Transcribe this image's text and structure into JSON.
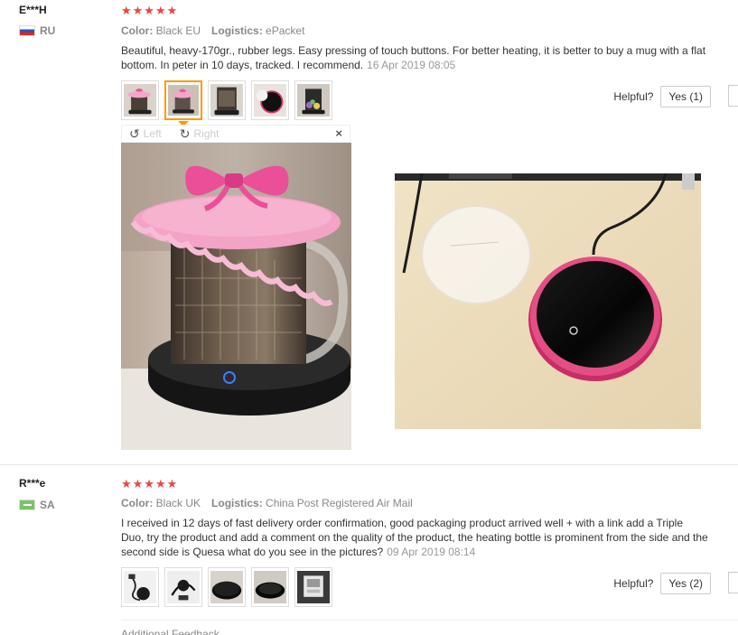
{
  "reviews": [
    {
      "user": "E***H",
      "country": "RU",
      "stars": "★★★★★",
      "color_label": "Color:",
      "color_value": "Black EU",
      "logistics_label": "Logistics:",
      "logistics_value": "ePacket",
      "text": "Beautiful, heavy-170gr., rubber legs. Easy pressing of touch buttons. For better heating, it is better to buy a mug with a flat bottom. In peter in 10 days, tracked. I recommend.",
      "date": "16 Apr 2019 08:05",
      "helpful_label": "Helpful?",
      "yes_label": "Yes (1)",
      "thumb_icons": [
        "mug-pink-lid-photo",
        "mug-pink-lid-photo",
        "mug-dark-photo",
        "warmer-photo",
        "mug-flowers-photo"
      ]
    },
    {
      "user": "R***e",
      "country": "SA",
      "stars": "★★★★★",
      "color_label": "Color:",
      "color_value": "Black UK",
      "logistics_label": "Logistics:",
      "logistics_value": "China Post Registered Air Mail",
      "text": "I received in 12 days of fast delivery order confirmation, good packaging product arrived well + with a link add a Triple Duo, try the product and add a comment on the quality of the product, the heating bottle is prominent from the side and the second side is Quesa what do you see in the pictures?",
      "date": "09 Apr 2019 08:14",
      "helpful_label": "Helpful?",
      "yes_label": "Yes (2)",
      "thumb_icons": [
        "cable-photo",
        "warmer-cable-photo",
        "warmer-black-photo",
        "warmer-top-photo",
        "box-photo"
      ]
    }
  ],
  "viewer": {
    "left_label": "Left",
    "right_label": "Right",
    "close_glyph": "×"
  },
  "additional_feedback": "Additional Feedback",
  "colors": {
    "star": "#ee4444",
    "accent": "#ff9900",
    "pink": "#f08ab8",
    "pad_ring": "#e0417a"
  }
}
